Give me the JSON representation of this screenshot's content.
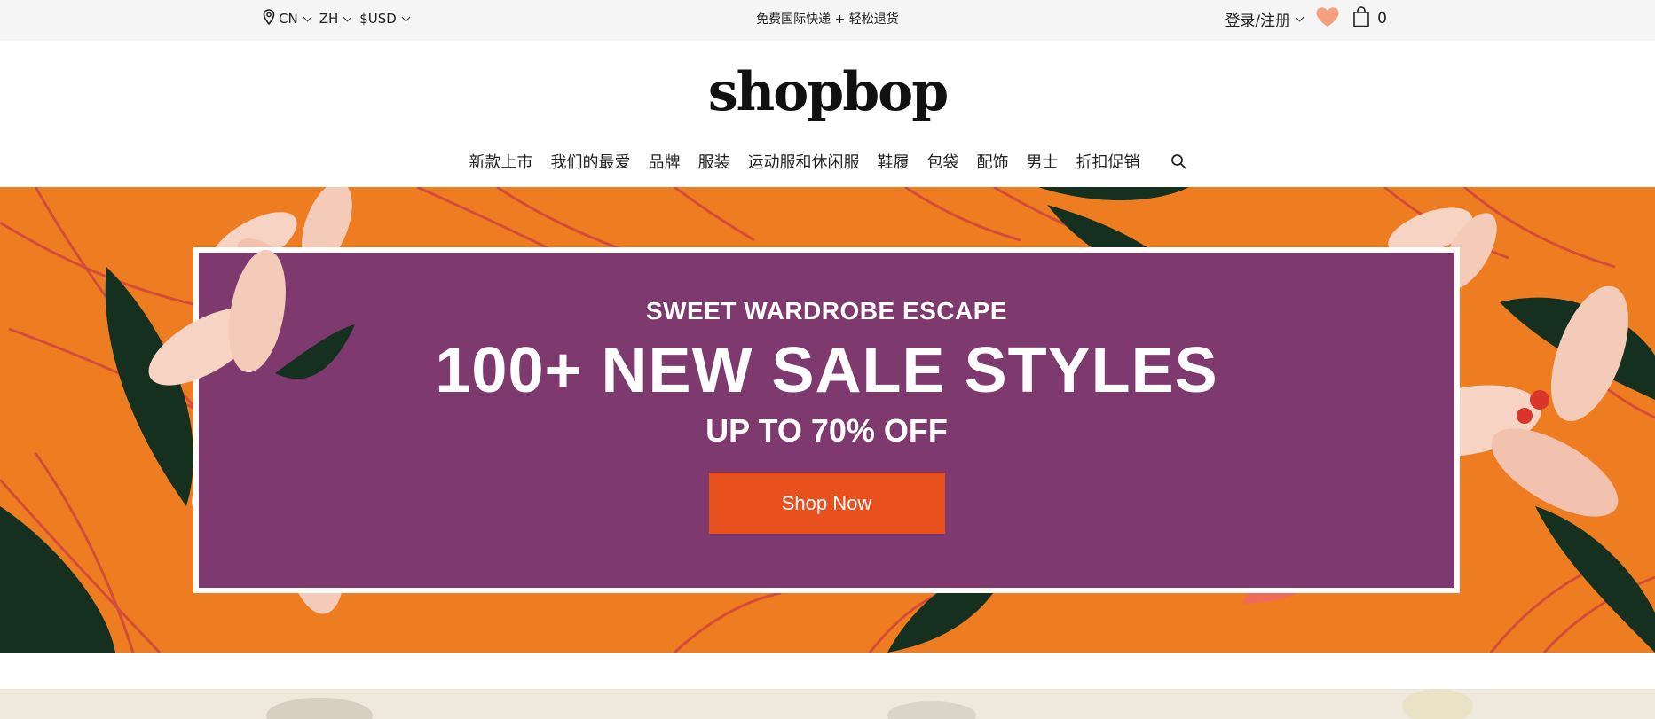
{
  "topbar": {
    "country": "CN",
    "language": "ZH",
    "currency": "$USD",
    "promo": "免费国际快递 + 轻松退货",
    "login": "登录/注册",
    "cart_count": "0"
  },
  "logo": {
    "text": "shopbop"
  },
  "nav": {
    "items": [
      "新款上市",
      "我们的最爱",
      "品牌",
      "服装",
      "运动服和休闲服",
      "鞋履",
      "包袋",
      "配饰",
      "男士",
      "折扣促销"
    ]
  },
  "hero": {
    "eyebrow": "SWEET WARDROBE ESCAPE",
    "headline": "100+ NEW SALE STYLES",
    "subheadline": "UP TO 70% OFF",
    "cta": "Shop Now"
  },
  "icons": {
    "location": "location-pin-icon",
    "heart": "heart-icon",
    "bag": "shopping-bag-icon",
    "search": "search-icon"
  },
  "colors": {
    "hero_orange": "#ee7d22",
    "panel_purple": "#7e3a6e",
    "cta_orange": "#e8501e",
    "heart_peach": "#f5a07e",
    "topbar_bg": "#f5f5f5"
  }
}
